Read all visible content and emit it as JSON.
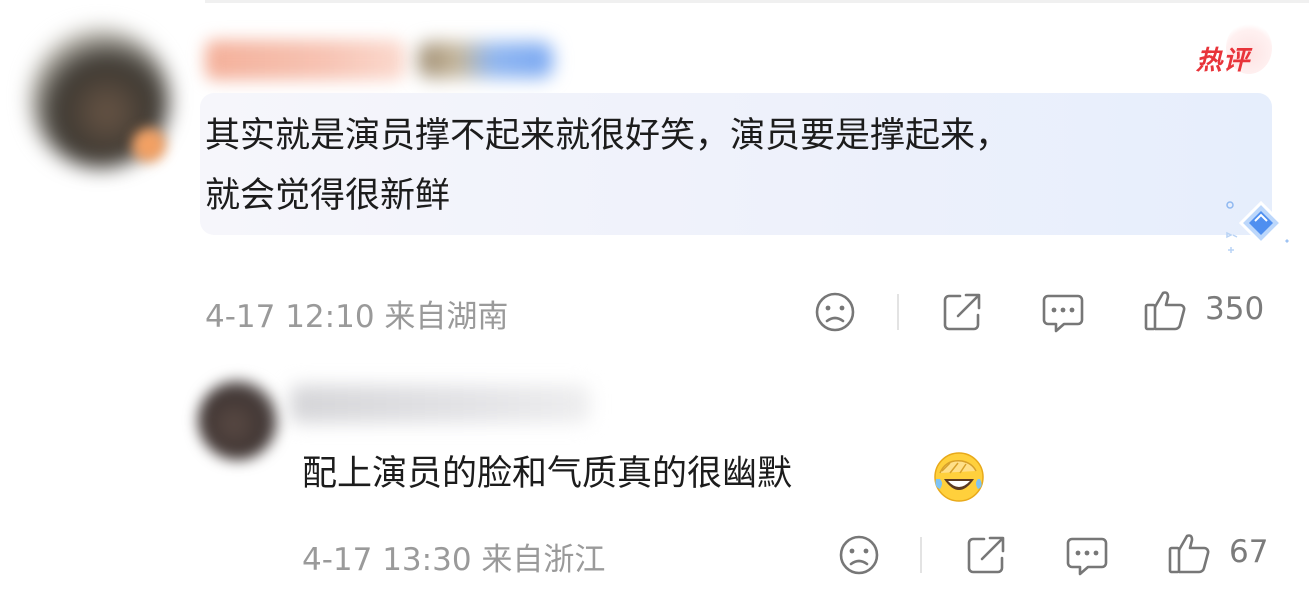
{
  "comments": [
    {
      "hot_badge": "热评",
      "text_line1": "其实就是演员撑不起来就很好笑，演员要是撑起来，",
      "text_line2": "就会觉得很新鲜",
      "time": "4-17 12:10",
      "location": "来自湖南",
      "like_count": "350"
    },
    {
      "text": "配上演员的脸和气质真的很幽默",
      "emoji": "laughing-crying-facepalm",
      "time": "4-17 13:30",
      "location": "来自浙江",
      "like_count": "67"
    }
  ],
  "icons": [
    "sad-face-icon",
    "share-icon",
    "comment-icon",
    "like-thumb-icon"
  ],
  "colors": {
    "hot": "#e8343a",
    "meta": "#9a9a9a",
    "bubble": "#eef1fb"
  }
}
